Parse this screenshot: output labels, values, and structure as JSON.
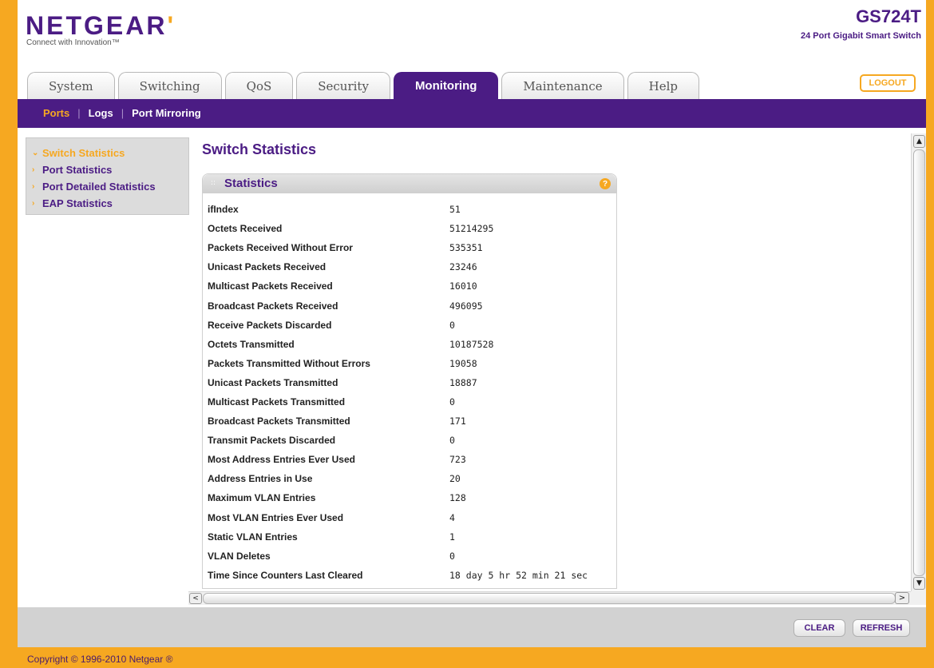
{
  "header": {
    "logo_text": "NETGEAR",
    "logo_mark": "'",
    "tagline": "Connect with Innovation™",
    "model": "GS724T",
    "model_subtitle": "24 Port Gigabit Smart Switch",
    "logout_label": "LOGOUT"
  },
  "tabs": [
    {
      "label": "System",
      "active": false
    },
    {
      "label": "Switching",
      "active": false
    },
    {
      "label": "QoS",
      "active": false
    },
    {
      "label": "Security",
      "active": false
    },
    {
      "label": "Monitoring",
      "active": true
    },
    {
      "label": "Maintenance",
      "active": false
    },
    {
      "label": "Help",
      "active": false
    }
  ],
  "subnav": [
    {
      "label": "Ports",
      "active": true
    },
    {
      "label": "Logs",
      "active": false
    },
    {
      "label": "Port Mirroring",
      "active": false
    }
  ],
  "sidebar": {
    "items": [
      {
        "label": "Switch Statistics",
        "active": true
      },
      {
        "label": "Port Statistics",
        "active": false
      },
      {
        "label": "Port Detailed Statistics",
        "active": false
      },
      {
        "label": "EAP Statistics",
        "active": false
      }
    ]
  },
  "main": {
    "page_title": "Switch Statistics",
    "panel_title": "Statistics",
    "help_icon_glyph": "?",
    "rows": [
      {
        "label": "ifIndex",
        "value": "51"
      },
      {
        "label": "Octets Received",
        "value": "51214295"
      },
      {
        "label": "Packets Received Without Error",
        "value": "535351"
      },
      {
        "label": "Unicast Packets Received",
        "value": "23246"
      },
      {
        "label": "Multicast Packets Received",
        "value": "16010"
      },
      {
        "label": "Broadcast Packets Received",
        "value": "496095"
      },
      {
        "label": "Receive Packets Discarded",
        "value": "0"
      },
      {
        "label": "Octets Transmitted",
        "value": "10187528"
      },
      {
        "label": "Packets Transmitted Without Errors",
        "value": "19058"
      },
      {
        "label": "Unicast Packets Transmitted",
        "value": "18887"
      },
      {
        "label": "Multicast Packets Transmitted",
        "value": "0"
      },
      {
        "label": "Broadcast Packets Transmitted",
        "value": "171"
      },
      {
        "label": "Transmit Packets Discarded",
        "value": "0"
      },
      {
        "label": "Most Address Entries Ever Used",
        "value": "723"
      },
      {
        "label": "Address Entries in Use",
        "value": "20"
      },
      {
        "label": "Maximum VLAN Entries",
        "value": "128"
      },
      {
        "label": "Most VLAN Entries Ever Used",
        "value": "4"
      },
      {
        "label": "Static VLAN Entries",
        "value": "1"
      },
      {
        "label": "VLAN Deletes",
        "value": "0"
      },
      {
        "label": "Time Since Counters Last Cleared",
        "value": "18 day 5 hr 52 min 21 sec"
      }
    ]
  },
  "footer": {
    "clear_label": "CLEAR",
    "refresh_label": "REFRESH",
    "copyright": "Copyright © 1996-2010 Netgear ®"
  },
  "icons": {
    "sidebar_active_arrow": "⌄",
    "sidebar_arrow": "›",
    "scroll_up": "▲",
    "scroll_down": "▼",
    "scroll_left": "<",
    "scroll_right": ">",
    "panel_grip": "::"
  },
  "colors": {
    "brand_purple": "#4b1c84",
    "brand_orange": "#f6a821"
  }
}
